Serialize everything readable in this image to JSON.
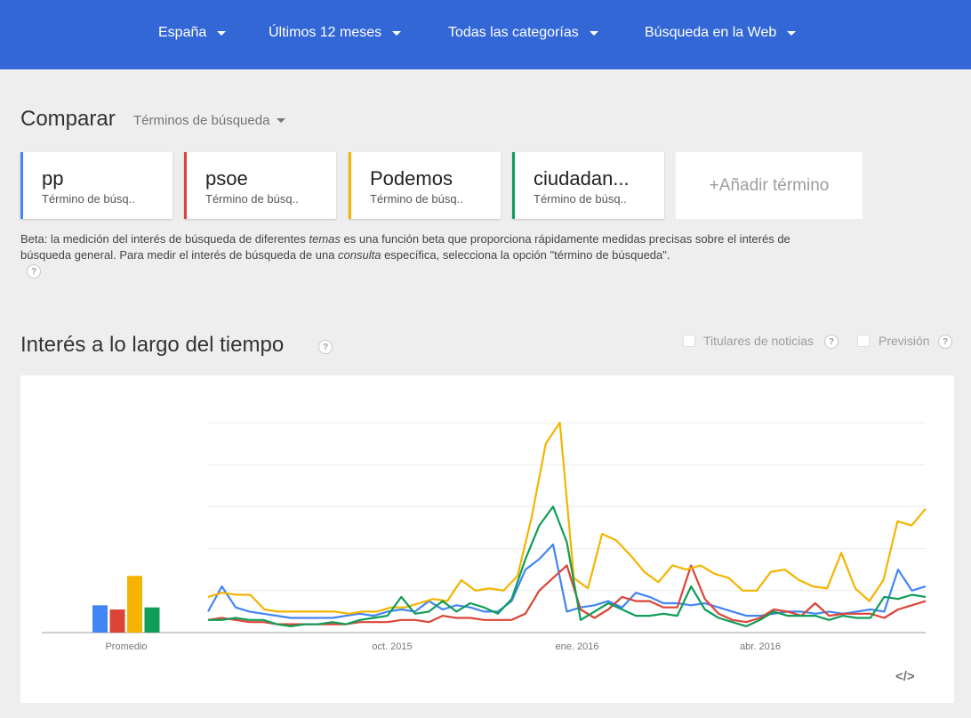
{
  "header": {
    "region": "España",
    "period": "Últimos 12 meses",
    "category": "Todas las categorías",
    "search_type": "Búsqueda en la Web"
  },
  "compare": {
    "title": "Comparar",
    "mode": "Términos de búsqueda",
    "terms": [
      {
        "name": "pp",
        "type": "Término de búsq..",
        "color": "#4285f4"
      },
      {
        "name": "psoe",
        "type": "Término de búsq..",
        "color": "#db4437"
      },
      {
        "name": "Podemos",
        "type": "Término de búsq..",
        "color": "#f4b400"
      },
      {
        "name": "ciudadan...",
        "type": "Término de búsq..",
        "color": "#0f9d58"
      }
    ],
    "add_term": "+Añadir término"
  },
  "beta_note": {
    "part1": "Beta: la medición del interés de búsqueda de diferentes ",
    "em1": "temas",
    "part2": " es una función beta que proporciona rápidamente medidas precisas sobre el interés de búsqueda general. Para medir el interés de búsqueda de una ",
    "em2": "consulta",
    "part3": " específica, selecciona la opción \"término de búsqueda\"."
  },
  "help_glyph": "?",
  "interest": {
    "title": "Interés a lo largo del tiempo",
    "news_headlines": "Titulares de noticias",
    "forecast": "Previsión",
    "embed_icon": "</>"
  },
  "chart_data": {
    "type": "line",
    "x_tick_labels": [
      "oct. 2015",
      "ene. 2016",
      "abr. 2016"
    ],
    "average_label": "Promedio",
    "ylim": [
      0,
      100
    ],
    "grid": true,
    "averages": [
      {
        "name": "pp",
        "value": 13
      },
      {
        "name": "psoe",
        "value": 11
      },
      {
        "name": "Podemos",
        "value": 27
      },
      {
        "name": "ciudadan...",
        "value": 12
      }
    ],
    "series": [
      {
        "name": "pp",
        "color": "#4285f4",
        "values": [
          10,
          22,
          12,
          10,
          9,
          8,
          7,
          7,
          7,
          7,
          8,
          9,
          8,
          10,
          11,
          10,
          15,
          11,
          13,
          12,
          10,
          10,
          15,
          30,
          35,
          42,
          10,
          12,
          13,
          15,
          12,
          19,
          17,
          14,
          14,
          13,
          14,
          12,
          10,
          8,
          8,
          9,
          10,
          10,
          9,
          10,
          9,
          10,
          11,
          10,
          30,
          20,
          22
        ]
      },
      {
        "name": "psoe",
        "color": "#db4437",
        "values": [
          6,
          7,
          6,
          5,
          5,
          4,
          4,
          4,
          4,
          4,
          4,
          5,
          5,
          5,
          6,
          6,
          5,
          8,
          7,
          7,
          6,
          6,
          6,
          9,
          20,
          26,
          32,
          11,
          7,
          11,
          17,
          15,
          15,
          12,
          12,
          32,
          16,
          9,
          6,
          5,
          7,
          11,
          10,
          8,
          14,
          8,
          9,
          9,
          9,
          7,
          11,
          13,
          15
        ]
      },
      {
        "name": "Podemos",
        "color": "#f4b400",
        "values": [
          17,
          19,
          18,
          18,
          11,
          10,
          10,
          10,
          10,
          10,
          9,
          10,
          10,
          12,
          12,
          14,
          16,
          15,
          25,
          20,
          21,
          20,
          27,
          55,
          90,
          100,
          26,
          21,
          47,
          44,
          37,
          29,
          24,
          32,
          30,
          32,
          28,
          26,
          20,
          20,
          29,
          30,
          25,
          22,
          21,
          38,
          21,
          15,
          25,
          53,
          51,
          59
        ]
      },
      {
        "name": "ciudadan...",
        "color": "#0f9d58",
        "values": [
          6,
          6,
          7,
          6,
          6,
          4,
          3,
          4,
          4,
          5,
          4,
          6,
          7,
          8,
          17,
          9,
          10,
          15,
          10,
          14,
          12,
          9,
          16,
          35,
          51,
          60,
          43,
          6,
          10,
          14,
          11,
          8,
          8,
          9,
          8,
          22,
          11,
          7,
          5,
          3,
          6,
          10,
          8,
          8,
          8,
          6,
          8,
          7,
          7,
          17,
          16,
          18,
          17
        ]
      }
    ]
  }
}
